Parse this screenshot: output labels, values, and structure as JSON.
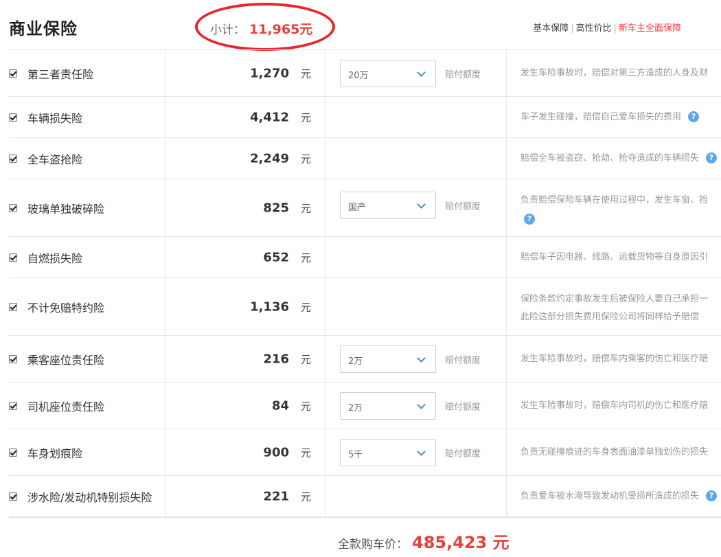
{
  "header": {
    "title": "商业保险",
    "subtotal_label": "小计：",
    "subtotal_value": "11,965元",
    "plans": [
      {
        "label": "基本保障"
      },
      {
        "label": "高性价比"
      },
      {
        "label": "新车主全面保障"
      }
    ]
  },
  "rows": [
    {
      "name": "第三者责任险",
      "price": "1,270",
      "unit": "元",
      "select": "20万",
      "select_label": "赔付额度",
      "desc": "发生车险事故时，赔偿对第三方造成的人身及财"
    },
    {
      "name": "车辆损失险",
      "price": "4,412",
      "unit": "元",
      "desc": "车子发生碰撞，赔偿自己爱车损失的费用"
    },
    {
      "name": "全车盗抢险",
      "price": "2,249",
      "unit": "元",
      "desc": "赔偿全车被盗窃、抢劫、抢夺造成的车辆损失"
    },
    {
      "name": "玻璃单独破碎险",
      "price": "825",
      "unit": "元",
      "select": "国产",
      "select_label": "赔付额度",
      "desc": "负责赔偿保险车辆在使用过程中，发生车窗、挡"
    },
    {
      "name": "自燃损失险",
      "price": "652",
      "unit": "元",
      "desc": "赔偿车子因电器、线路、运载货物等自身原因引"
    },
    {
      "name": "不计免赔特约险",
      "price": "1,136",
      "unit": "元",
      "desc": "保险条款约定事故发生后被保险人要自己承担一",
      "desc2": "此险这部分损失费用保险公司将同样给予赔偿"
    },
    {
      "name": "乘客座位责任险",
      "price": "216",
      "unit": "元",
      "select": "2万",
      "select_label": "赔付额度",
      "desc": "发生车险事故时，赔偿车内乘客的伤亡和医疗赔"
    },
    {
      "name": "司机座位责任险",
      "price": "84",
      "unit": "元",
      "select": "2万",
      "select_label": "赔付额度",
      "desc": "发生车险事故时，赔偿车内司机的伤亡和医疗赔"
    },
    {
      "name": "车身划痕险",
      "price": "900",
      "unit": "元",
      "select": "5千",
      "select_label": "赔付额度",
      "desc": "负责无碰撞痕迹的车身表面油漆单独划伤的损失"
    },
    {
      "name": "涉水险/发动机特别损失险",
      "price": "221",
      "unit": "元",
      "desc": "负责爱车被水淹导致发动机受损所造成的损失"
    }
  ],
  "footer": {
    "total_label": "全款购车价：",
    "total_value": "485,423 元"
  },
  "colors": {
    "accent_red": "#e8403b",
    "annotation_red": "#e8262c",
    "help_blue": "#5ca8e8"
  },
  "icons": {
    "help": "?"
  }
}
